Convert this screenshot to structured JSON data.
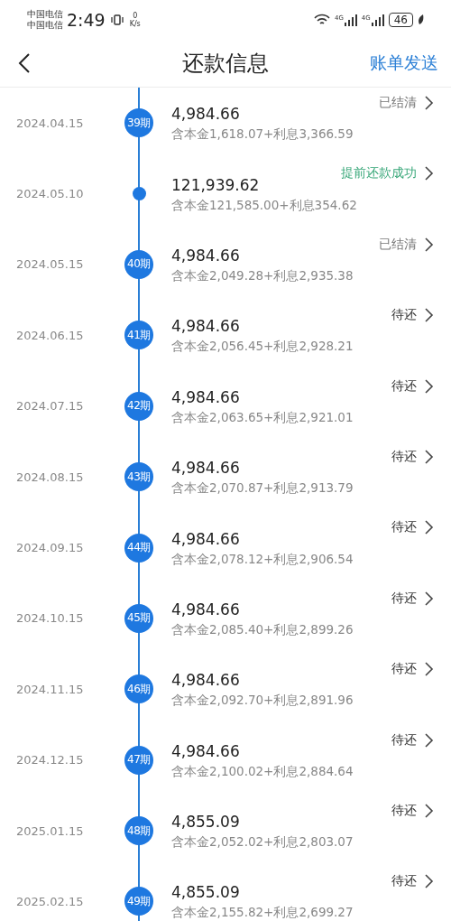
{
  "status_bar": {
    "carriers": [
      "中国电信",
      "中国电信"
    ],
    "time": "2:49",
    "speed_value": "0",
    "speed_unit": "K/s",
    "signals": [
      "4G",
      "4G"
    ],
    "battery": "46"
  },
  "header": {
    "title": "还款信息",
    "action": "账单发送"
  },
  "rows": [
    {
      "date": "2024.04.15",
      "kind": "period",
      "period": "39期",
      "amount": "4,984.66",
      "detail": "含本金1,618.07+利息3,366.59",
      "status": "已结清",
      "color": "#777777"
    },
    {
      "date": "2024.05.10",
      "kind": "dot",
      "amount": "121,939.62",
      "detail": "含本金121,585.00+利息354.62",
      "status": "提前还款成功",
      "color": "#3aa87a"
    },
    {
      "date": "2024.05.15",
      "kind": "period",
      "period": "40期",
      "amount": "4,984.66",
      "detail": "含本金2,049.28+利息2,935.38",
      "status": "已结清",
      "color": "#777777"
    },
    {
      "date": "2024.06.15",
      "kind": "period",
      "period": "41期",
      "amount": "4,984.66",
      "detail": "含本金2,056.45+利息2,928.21",
      "status": "待还",
      "color": "#333333"
    },
    {
      "date": "2024.07.15",
      "kind": "period",
      "period": "42期",
      "amount": "4,984.66",
      "detail": "含本金2,063.65+利息2,921.01",
      "status": "待还",
      "color": "#333333"
    },
    {
      "date": "2024.08.15",
      "kind": "period",
      "period": "43期",
      "amount": "4,984.66",
      "detail": "含本金2,070.87+利息2,913.79",
      "status": "待还",
      "color": "#333333"
    },
    {
      "date": "2024.09.15",
      "kind": "period",
      "period": "44期",
      "amount": "4,984.66",
      "detail": "含本金2,078.12+利息2,906.54",
      "status": "待还",
      "color": "#333333"
    },
    {
      "date": "2024.10.15",
      "kind": "period",
      "period": "45期",
      "amount": "4,984.66",
      "detail": "含本金2,085.40+利息2,899.26",
      "status": "待还",
      "color": "#333333"
    },
    {
      "date": "2024.11.15",
      "kind": "period",
      "period": "46期",
      "amount": "4,984.66",
      "detail": "含本金2,092.70+利息2,891.96",
      "status": "待还",
      "color": "#333333"
    },
    {
      "date": "2024.12.15",
      "kind": "period",
      "period": "47期",
      "amount": "4,984.66",
      "detail": "含本金2,100.02+利息2,884.64",
      "status": "待还",
      "color": "#333333"
    },
    {
      "date": "2025.01.15",
      "kind": "period",
      "period": "48期",
      "amount": "4,855.09",
      "detail": "含本金2,052.02+利息2,803.07",
      "status": "待还",
      "color": "#333333"
    },
    {
      "date": "2025.02.15",
      "kind": "period",
      "period": "49期",
      "amount": "4,855.09",
      "detail": "含本金2,155.82+利息2,699.27",
      "status": "待还",
      "color": "#333333"
    }
  ]
}
